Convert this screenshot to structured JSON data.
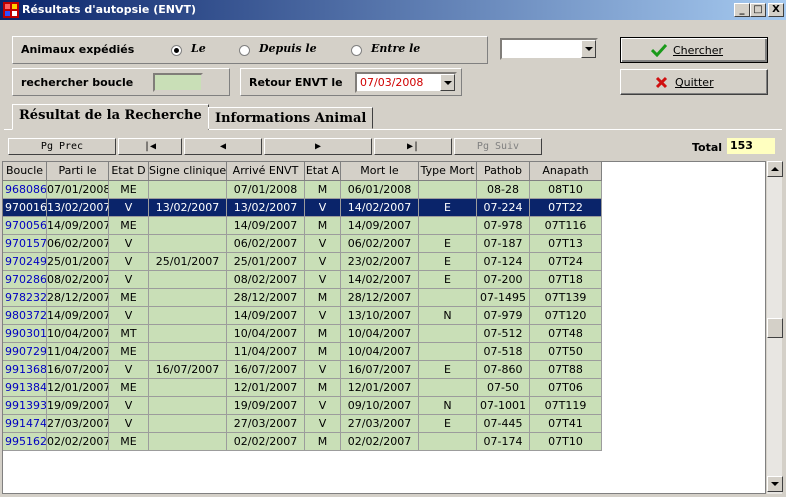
{
  "window": {
    "title": "Résultats d'autopsie (ENVT)",
    "controls": [
      "_",
      "□",
      "X"
    ]
  },
  "search": {
    "animaux_label": "Animaux expédiés",
    "radio_le": "Le",
    "radio_depuis": "Depuis le",
    "radio_entre": "Entre le",
    "selected_radio": "Le",
    "boucle_label": "rechercher boucle",
    "boucle_value": "",
    "retour_label": "Retour ENVT le",
    "retour_value": "07/03/2008",
    "top_combo_value": "",
    "chercher_label": "Chercher",
    "quitter_label": "Quitter"
  },
  "tabs": {
    "active": "Résultat de la Recherche",
    "other": "Informations Animal"
  },
  "nav": {
    "prev_label": "Pg Prec",
    "first_glyph": "|◀",
    "back_glyph": "◀",
    "fwd_glyph": "▶",
    "last_glyph": "▶|",
    "next_label": "Pg Suiv",
    "total_label": "Total",
    "total_value": "153"
  },
  "table": {
    "columns": [
      "Boucle",
      "Parti le",
      "Etat D",
      "Signe clinique",
      "Arrivé ENVT",
      "Etat A",
      "Mort le",
      "Type Mort",
      "Pathob",
      "Anapath"
    ],
    "rows": [
      [
        "968086",
        "07/01/2008",
        "ME",
        "",
        "07/01/2008",
        "M",
        "06/01/2008",
        "",
        "08-28",
        "08T10"
      ],
      [
        "970016",
        "13/02/2007",
        "V",
        "13/02/2007",
        "13/02/2007",
        "V",
        "14/02/2007",
        "E",
        "07-224",
        "07T22"
      ],
      [
        "970056",
        "14/09/2007",
        "ME",
        "",
        "14/09/2007",
        "M",
        "14/09/2007",
        "",
        "07-978",
        "07T116"
      ],
      [
        "970157",
        "06/02/2007",
        "V",
        "",
        "06/02/2007",
        "V",
        "06/02/2007",
        "E",
        "07-187",
        "07T13"
      ],
      [
        "970249",
        "25/01/2007",
        "V",
        "25/01/2007",
        "25/01/2007",
        "V",
        "23/02/2007",
        "E",
        "07-124",
        "07T24"
      ],
      [
        "970286",
        "08/02/2007",
        "V",
        "",
        "08/02/2007",
        "V",
        "14/02/2007",
        "E",
        "07-200",
        "07T18"
      ],
      [
        "978232",
        "28/12/2007",
        "ME",
        "",
        "28/12/2007",
        "M",
        "28/12/2007",
        "",
        "07-1495",
        "07T139"
      ],
      [
        "980372",
        "14/09/2007",
        "V",
        "",
        "14/09/2007",
        "V",
        "13/10/2007",
        "N",
        "07-979",
        "07T120"
      ],
      [
        "990301",
        "10/04/2007",
        "MT",
        "",
        "10/04/2007",
        "M",
        "10/04/2007",
        "",
        "07-512",
        "07T48"
      ],
      [
        "990729",
        "11/04/2007",
        "ME",
        "",
        "11/04/2007",
        "M",
        "10/04/2007",
        "",
        "07-518",
        "07T50"
      ],
      [
        "991368",
        "16/07/2007",
        "V",
        "16/07/2007",
        "16/07/2007",
        "V",
        "16/07/2007",
        "E",
        "07-860",
        "07T88"
      ],
      [
        "991384",
        "12/01/2007",
        "ME",
        "",
        "12/01/2007",
        "M",
        "12/01/2007",
        "",
        "07-50",
        "07T06"
      ],
      [
        "991393",
        "19/09/2007",
        "V",
        "",
        "19/09/2007",
        "V",
        "09/10/2007",
        "N",
        "07-1001",
        "07T119"
      ],
      [
        "991474",
        "27/03/2007",
        "V",
        "",
        "27/03/2007",
        "V",
        "27/03/2007",
        "E",
        "07-445",
        "07T41"
      ],
      [
        "995162",
        "02/02/2007",
        "ME",
        "",
        "02/02/2007",
        "M",
        "02/02/2007",
        "",
        "07-174",
        "07T10"
      ]
    ],
    "selected_row": 1
  },
  "colors": {
    "grid_bg": "#c9dfb7",
    "selection": "#0a246a",
    "boucle_text": "#0000c0",
    "date_red": "#d00000",
    "total_bg": "#ffffc0"
  }
}
